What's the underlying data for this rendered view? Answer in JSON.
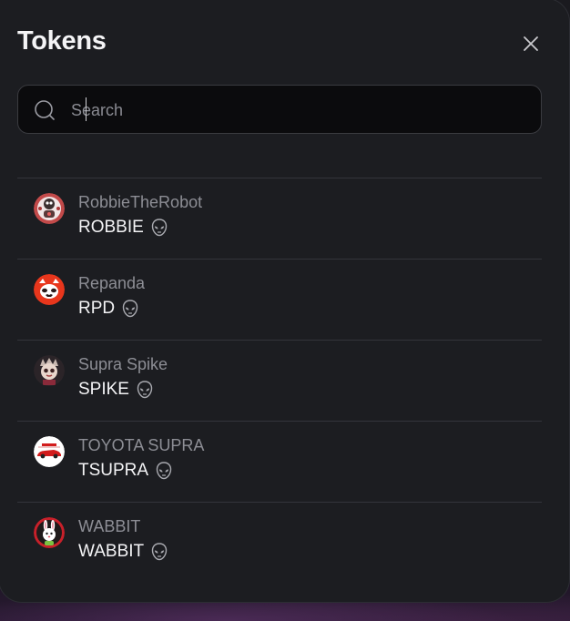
{
  "modal": {
    "title": "Tokens",
    "close_icon": "close-icon"
  },
  "search": {
    "placeholder": "Search",
    "value": "",
    "icon": "search-icon"
  },
  "tokens": [
    {
      "name": "RobbieTheRobot",
      "symbol": "ROBBIE",
      "avatar_icon": "robot-avatar",
      "badge_icon": "alien-icon"
    },
    {
      "name": "Repanda",
      "symbol": "RPD",
      "avatar_icon": "red-panda-avatar",
      "badge_icon": "alien-icon"
    },
    {
      "name": "Supra Spike",
      "symbol": "SPIKE",
      "avatar_icon": "spike-avatar",
      "badge_icon": "alien-icon"
    },
    {
      "name": "TOYOTA SUPRA",
      "symbol": "TSUPRA",
      "avatar_icon": "supra-car-avatar",
      "badge_icon": "alien-icon"
    },
    {
      "name": "WABBIT",
      "symbol": "WABBIT",
      "avatar_icon": "rabbit-avatar",
      "badge_icon": "alien-icon"
    }
  ],
  "colors": {
    "modal_bg": "#1c1d21",
    "search_bg": "#0b0b0d",
    "divider": "#34353b",
    "name_text": "#8d8e95",
    "symbol_text": "#f4f4f6"
  }
}
